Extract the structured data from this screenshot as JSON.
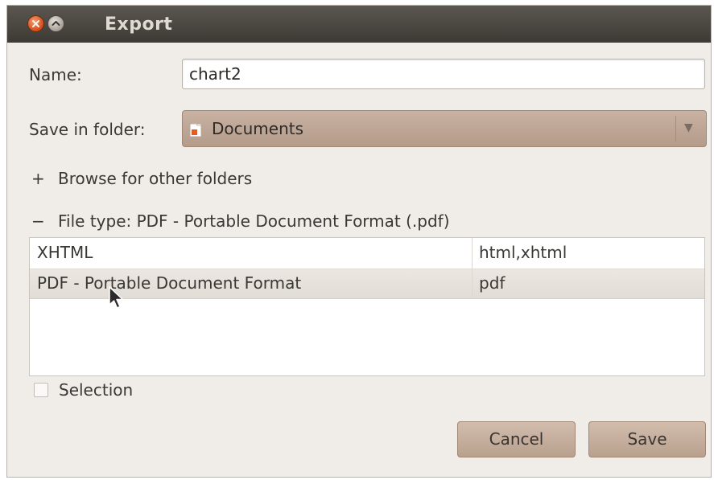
{
  "window": {
    "title": "Export"
  },
  "form": {
    "name_label": "Name:",
    "name_value": "chart2",
    "folder_label": "Save in folder:",
    "folder_value": "Documents",
    "browse_expander_symbol": "+",
    "browse_label": "Browse for other folders",
    "filetype_expander_symbol": "−",
    "filetype_label": "File type: PDF - Portable Document Format (.pdf)"
  },
  "file_types": {
    "rows": [
      {
        "name": "XHTML",
        "extensions": "html,xhtml"
      },
      {
        "name": "PDF - Portable Document Format",
        "extensions": "pdf"
      }
    ],
    "selected_index": 1
  },
  "selection": {
    "label": "Selection",
    "checked": false
  },
  "buttons": {
    "cancel": "Cancel",
    "save": "Save"
  },
  "icons": {
    "close": "close-icon",
    "minimize": "minimize-icon",
    "folder": "folder-icon",
    "dropdown": "chevron-down-icon",
    "cursor": "mouse-pointer-icon"
  },
  "colors": {
    "titlebar": "#3d3a35",
    "close_button": "#d3521f",
    "button_fill": "#c6af9f",
    "selected_row": "#e6e0da",
    "dialog_background": "#f0ede9"
  }
}
